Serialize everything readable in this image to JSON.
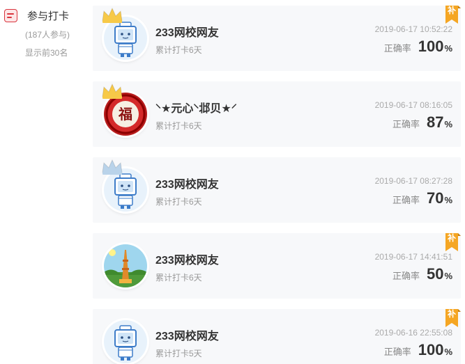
{
  "sidebar": {
    "title": "参与打卡",
    "participants": "(187人参与)",
    "showing": "显示前30名"
  },
  "entries": [
    {
      "name": "233网校网友",
      "days": "累计打卡6天",
      "time": "2019-06-17 10:52:22",
      "rate_label": "正确率",
      "rate": "100",
      "unit": "%",
      "avatar": "robot",
      "crown": "gold",
      "makeup": "补"
    },
    {
      "name": "⸌★元心⸌邶贝★⸍",
      "days": "累计打卡6天",
      "time": "2019-06-17 08:16:05",
      "rate_label": "正确率",
      "rate": "87",
      "unit": "%",
      "avatar": "fu",
      "crown": "gold",
      "makeup": ""
    },
    {
      "name": "233网校网友",
      "days": "累计打卡6天",
      "time": "2019-06-17 08:27:28",
      "rate_label": "正确率",
      "rate": "70",
      "unit": "%",
      "avatar": "robot",
      "crown": "silver",
      "makeup": ""
    },
    {
      "name": "233网校网友",
      "days": "累计打卡6天",
      "time": "2019-06-17 14:41:51",
      "rate_label": "正确率",
      "rate": "50",
      "unit": "%",
      "avatar": "tower",
      "crown": "",
      "makeup": "补"
    },
    {
      "name": "233网校网友",
      "days": "累计打卡5天",
      "time": "2019-06-16 22:55:08",
      "rate_label": "正确率",
      "rate": "100",
      "unit": "%",
      "avatar": "robot",
      "crown": "",
      "makeup": "补"
    }
  ],
  "colors": {
    "accent": "#d9343d",
    "badge": "#f5a623",
    "crown_gold": "#f7c948",
    "crown_silver": "#b9d3ea"
  }
}
